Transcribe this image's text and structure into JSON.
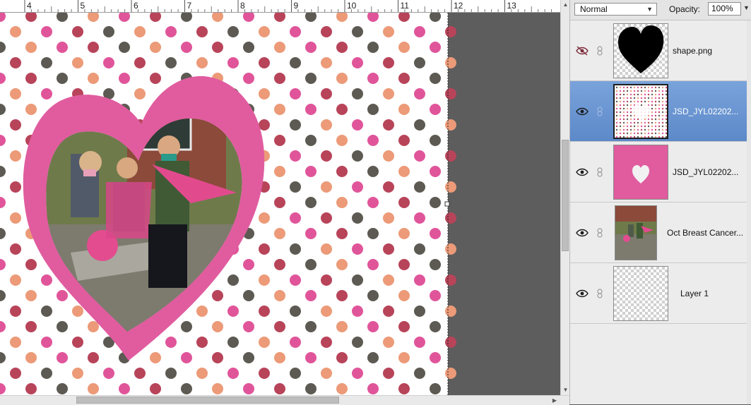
{
  "ruler": {
    "labels": [
      "4",
      "5",
      "6",
      "7",
      "8",
      "9",
      "10",
      "11",
      "12",
      "13"
    ]
  },
  "layers_panel": {
    "blend_mode": "Normal",
    "opacity_label": "Opacity:",
    "opacity_value": "100%",
    "layers": [
      {
        "name": "shape.png",
        "visible": false,
        "selected": false,
        "thumb": "black-heart-shape"
      },
      {
        "name": "JSD_JYL02202...",
        "visible": true,
        "selected": true,
        "thumb": "polka-dot-paper"
      },
      {
        "name": "JSD_JYL02202...",
        "visible": true,
        "selected": false,
        "thumb": "pink-heart-frame"
      },
      {
        "name": "Oct Breast Cancer...",
        "visible": true,
        "selected": false,
        "thumb": "photo"
      },
      {
        "name": "Layer 1",
        "visible": true,
        "selected": false,
        "thumb": "transparent"
      }
    ]
  },
  "colors": {
    "dot_pink": "#e0559a",
    "dot_red": "#b8445a",
    "dot_peach": "#ec9a78",
    "dot_gray": "#5c5a52",
    "frame_pink": "#e05c9f",
    "selection": "#6a96d4"
  }
}
